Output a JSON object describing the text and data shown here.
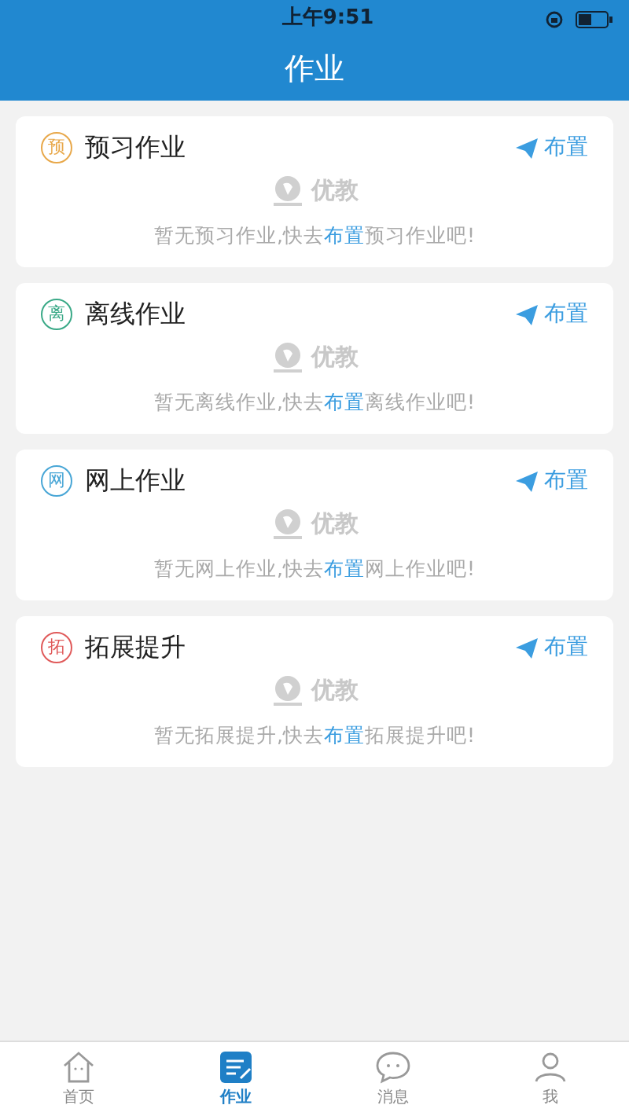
{
  "status_bar": {
    "time": "上午9:51"
  },
  "header": {
    "title": "作业"
  },
  "sections": [
    {
      "badge": "预",
      "color": "#e8a84a",
      "title": "预习作业",
      "action": "布置",
      "logo_text": "优教",
      "message_before": "暂无预习作业,快去",
      "message_link": "布置",
      "message_after": "预习作业吧!"
    },
    {
      "badge": "离",
      "color": "#3aa987",
      "title": "离线作业",
      "action": "布置",
      "logo_text": "优教",
      "message_before": "暂无离线作业,快去",
      "message_link": "布置",
      "message_after": "离线作业吧!"
    },
    {
      "badge": "网",
      "color": "#48a6d6",
      "title": "网上作业",
      "action": "布置",
      "logo_text": "优教",
      "message_before": "暂无网上作业,快去",
      "message_link": "布置",
      "message_after": "网上作业吧!"
    },
    {
      "badge": "拓",
      "color": "#e05a5a",
      "title": "拓展提升",
      "action": "布置",
      "logo_text": "优教",
      "message_before": "暂无拓展提升,快去",
      "message_link": "布置",
      "message_after": "拓展提升吧!"
    }
  ],
  "tab_bar": [
    {
      "kind": "home",
      "label": "首页",
      "selected": false
    },
    {
      "kind": "homework",
      "label": "作业",
      "selected": true
    },
    {
      "kind": "message",
      "label": "消息",
      "selected": false
    },
    {
      "kind": "me",
      "label": "我",
      "selected": false
    }
  ]
}
